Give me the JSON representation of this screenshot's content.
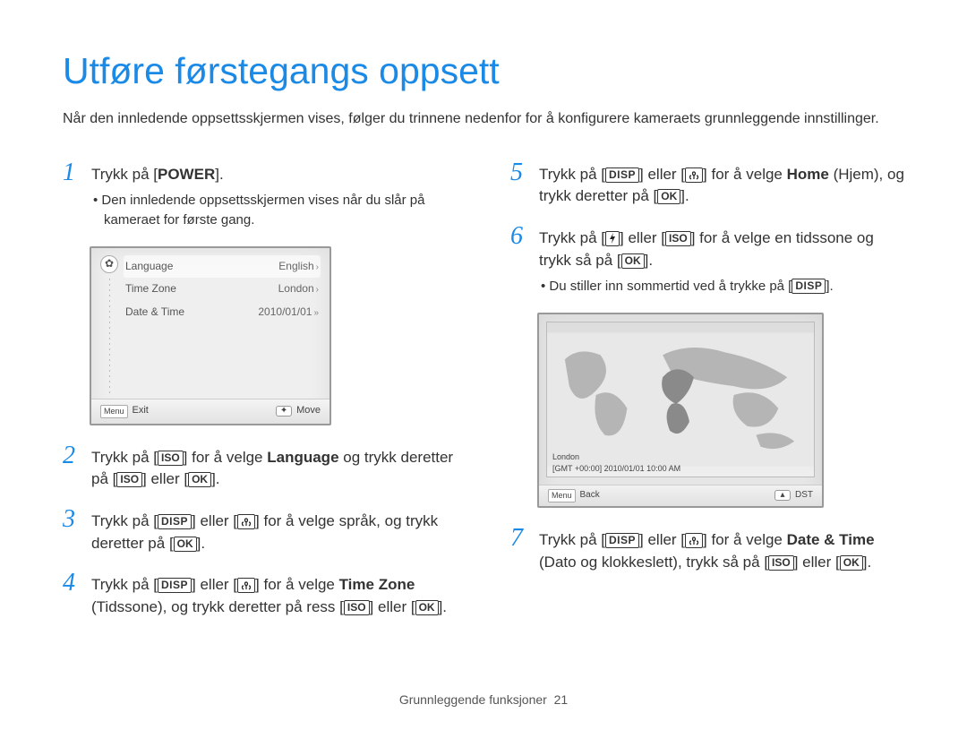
{
  "title": "Utføre førstegangs oppsett",
  "intro": "Når den innledende oppsettsskjermen vises, følger du trinnene nedenfor for å konfigurere kameraets grunnleggende innstillinger.",
  "keys": {
    "disp": "DISP",
    "iso": "ISO",
    "ok": "OK",
    "menu": "Menu"
  },
  "steps": {
    "s1": {
      "text_pre": "Trykk på [",
      "power": "POWER",
      "text_post": "].",
      "bullet": "Den innledende oppsettsskjermen vises når du slår på kameraet for første gang."
    },
    "s2": {
      "p1": "Trykk på [",
      "p2": "] for å velge ",
      "lang": "Language",
      "p3": " og trykk deretter på [",
      "p4": "] eller [",
      "p5": "]."
    },
    "s3": {
      "p1": "Trykk på [",
      "p2": "] eller [",
      "p3": "] for å velge språk, og trykk deretter på [",
      "p4": "]."
    },
    "s4": {
      "p1": "Trykk på [",
      "p2": "] eller [",
      "p3": "] for å velge ",
      "tz": "Time Zone",
      "p4": " (Tidssone), og trykk deretter på ress [",
      "p5": "] eller [",
      "p6": "]."
    },
    "s5": {
      "p1": "Trykk på [",
      "p2": "] eller [",
      "p3": "] for å velge ",
      "home": "Home",
      "home_par": " (Hjem), og trykk deretter på [",
      "p4": "]."
    },
    "s6": {
      "p1": "Trykk på [",
      "p2": "] eller [",
      "p3": "] for å velge en tidssone og trykk så på [",
      "p4": "].",
      "bullet_pre": "Du stiller inn sommertid ved å trykke på [",
      "bullet_post": "]."
    },
    "s7": {
      "p1": "Trykk på [",
      "p2": "] eller [",
      "p3": "] for å velge ",
      "dt": "Date & Time",
      "p4": " (Dato og klokkeslett), trykk så på [",
      "p5": "] eller [",
      "p6": "]."
    }
  },
  "lcd1": {
    "rows": [
      {
        "label": "Language",
        "value": "English"
      },
      {
        "label": "Time Zone",
        "value": "London"
      },
      {
        "label": "Date & Time",
        "value": "2010/01/01"
      }
    ],
    "footer_exit": "Exit",
    "footer_move": "Move"
  },
  "lcd2": {
    "city": "London",
    "detail": "[GMT +00:00] 2010/01/01 10:00 AM",
    "footer_back": "Back",
    "footer_dst": "DST"
  },
  "footer": {
    "section": "Grunnleggende funksjoner",
    "page": "21"
  }
}
